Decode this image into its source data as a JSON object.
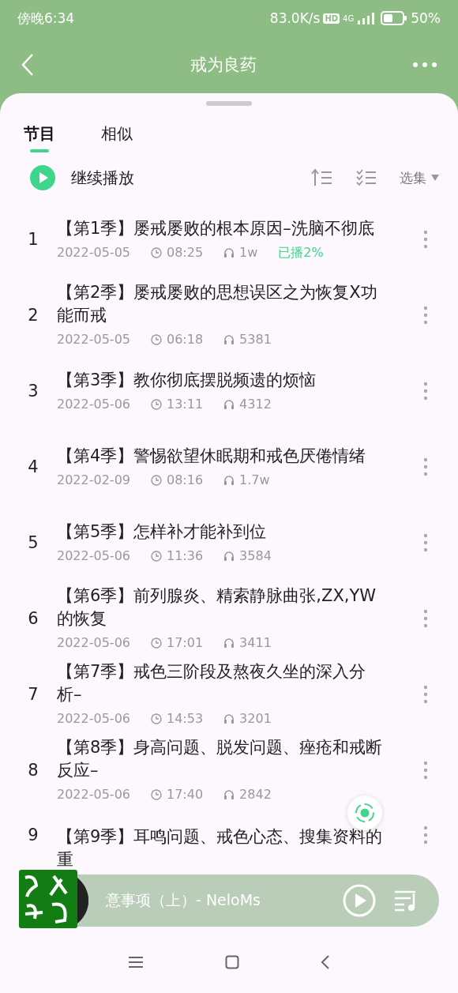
{
  "status_bar": {
    "time": "傍晚6:34",
    "speed": "83.0K/s",
    "hd": "HD",
    "network": "4G",
    "battery": "50%"
  },
  "nav": {
    "title": "戒为良药"
  },
  "tabs": [
    {
      "label": "节目",
      "selected": true
    },
    {
      "label": "相似",
      "selected": false
    }
  ],
  "toolbar": {
    "continue": "继续播放",
    "episodes": "选集"
  },
  "episodes": [
    {
      "number": "1",
      "title": "【第1季】屡戒屡败的根本原因–洗脑不彻底",
      "date": "2022-05-05",
      "duration": "08:25",
      "plays": "1w",
      "progress": "已播2%"
    },
    {
      "number": "2",
      "title": "【第2季】屡戒屡败的思想误区之为恢复X功能而戒",
      "date": "2022-05-05",
      "duration": "06:18",
      "plays": "5381"
    },
    {
      "number": "3",
      "title": "【第3季】教你彻底摆脱频遗的烦恼",
      "date": "2022-05-06",
      "duration": "13:11",
      "plays": "4312"
    },
    {
      "number": "4",
      "title": "【第4季】警惕欲望休眠期和戒色厌倦情绪",
      "date": "2022-02-09",
      "duration": "08:16",
      "plays": "1.7w"
    },
    {
      "number": "5",
      "title": "【第5季】怎样补才能补到位",
      "date": "2022-05-06",
      "duration": "11:36",
      "plays": "3584"
    },
    {
      "number": "6",
      "title": "【第6季】前列腺炎、精索静脉曲张,ZX,YW的恢复",
      "date": "2022-05-06",
      "duration": "17:01",
      "plays": "3411"
    },
    {
      "number": "7",
      "title": "【第7季】戒色三阶段及熬夜久坐的深入分析–",
      "date": "2022-05-06",
      "duration": "14:53",
      "plays": "3201"
    },
    {
      "number": "8",
      "title": "【第8季】身高问题、脱发问题、痤疮和戒断反应–",
      "date": "2022-05-06",
      "duration": "17:40",
      "plays": "2842"
    },
    {
      "number": "9",
      "title": "【第9季】耳鸣问题、戒色心态、搜集资料的重"
    }
  ],
  "player": {
    "track": "意事项（上）- NeloMs"
  }
}
